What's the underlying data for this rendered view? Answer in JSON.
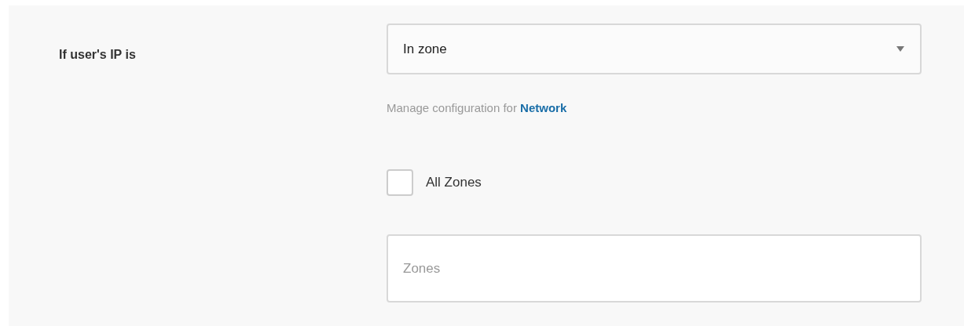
{
  "label": "If user's IP is",
  "dropdown": {
    "value": "In zone"
  },
  "helper": {
    "text": "Manage configuration for",
    "link": "Network"
  },
  "all_zones": {
    "label": "All Zones",
    "checked": false
  },
  "zones_field": {
    "placeholder": "Zones"
  }
}
